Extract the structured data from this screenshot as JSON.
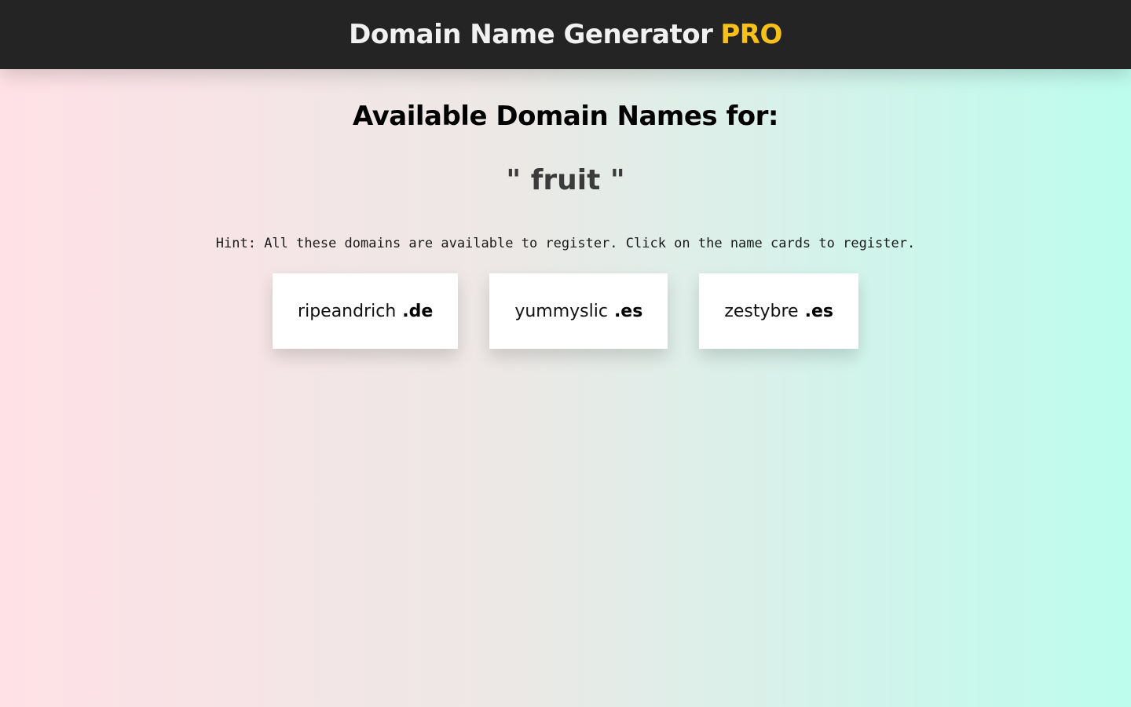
{
  "header": {
    "title": "Domain Name Generator",
    "badge": "PRO",
    "badge_color": "#f8c11a"
  },
  "main": {
    "heading": "Available Domain Names for:",
    "query_display": "\" fruit \"",
    "hint": "Hint: All these domains are available to register. Click on the name cards to register.",
    "domains": [
      {
        "name": "ripeandrich",
        "tld": ".de"
      },
      {
        "name": "yummyslic",
        "tld": ".es"
      },
      {
        "name": "zestybre",
        "tld": ".es"
      }
    ]
  }
}
